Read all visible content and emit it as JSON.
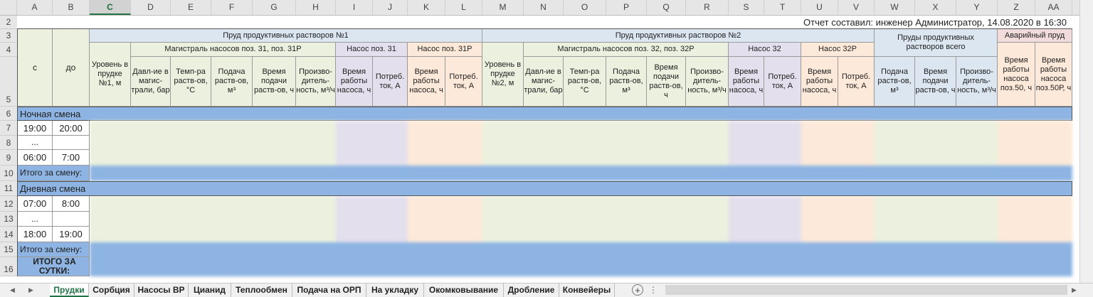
{
  "columns": [
    "A",
    "B",
    "C",
    "D",
    "E",
    "F",
    "G",
    "H",
    "I",
    "J",
    "K",
    "L",
    "M",
    "N",
    "O",
    "P",
    "Q",
    "R",
    "S",
    "T",
    "U",
    "V",
    "W",
    "X",
    "Y",
    "Z",
    "AA"
  ],
  "selected_column": "C",
  "rows": [
    "2",
    "3",
    "4",
    "5",
    "6",
    "7",
    "8",
    "9",
    "10",
    "11",
    "12",
    "13",
    "14",
    "15",
    "16"
  ],
  "report_author": "Отчет составил: инженер Администратор, 14.08.2020 в 16:30",
  "headers": {
    "from": "с",
    "to": "до",
    "pond1": "Пруд продуктивных растворов №1",
    "pond2": "Пруд продуктивных растворов №2",
    "ponds_total": "Пруды продуктивных растворов всего",
    "emergency": "Аварийный пруд",
    "main1": "Магистраль насосов поз. 31, поз. 31Р",
    "main2": "Магистраль насосов поз. 32, поз. 32Р",
    "pump31": "Насос поз. 31",
    "pump31r": "Насос поз. 31Р",
    "pump32": "Насос 32",
    "pump32r": "Насос 32Р",
    "level1": "Уровень в прудке №1, м",
    "level2": "Уровень в прудке №2, м",
    "pressure": "Давл-ие в магис-трали, бар",
    "temp": "Темп-ра раств-ов, °С",
    "feed": "Подача раств-ов, м³",
    "feed_time": "Время подачи раств-ов, ч",
    "capacity": "Произво-дитель-ность, м³/ч",
    "pump_time": "Время работы насоса, ч",
    "current": "Потреб. ток, А",
    "pump50": "Время работы насоса поз.50, ч",
    "pump50r": "Время работы насоса поз.50Р, ч"
  },
  "sections": {
    "night": "Ночная смена",
    "day": "Дневная смена",
    "shift_total": "Итого за смену:",
    "day_total": "ИТОГО ЗА СУТКИ:"
  },
  "times": {
    "r7_from": "19:00",
    "r7_to": "20:00",
    "r8": "...",
    "r9_from": "06:00",
    "r9_to": "7:00",
    "r12_from": "07:00",
    "r12_to": "8:00",
    "r13": "...",
    "r14_from": "18:00",
    "r14_to": "19:00"
  },
  "tabs": [
    "Прудки",
    "Сорбция",
    "Насосы ВР",
    "Цианид",
    "Теплообмен",
    "Подача на ОРП",
    "На укладку",
    "Окомковывание",
    "Дробление",
    "Конвейеры"
  ],
  "active_tab": "Прудки",
  "colors": {
    "pond_header": "#dce6f1",
    "green": "#ebf1de",
    "purple": "#e4dfec",
    "peach": "#fde9d9",
    "emergency_header": "#f2dcdb",
    "blue_band": "#8db4e2",
    "excel_green": "#217346"
  }
}
